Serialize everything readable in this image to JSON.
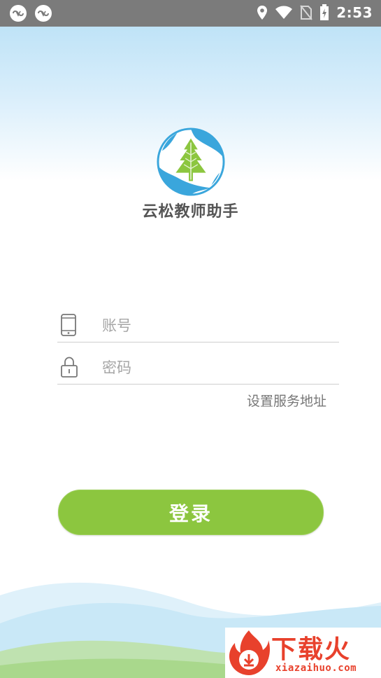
{
  "status_bar": {
    "time": "2:53",
    "icons": [
      "app-notification-icon",
      "app-notification-icon",
      "location-icon",
      "wifi-icon",
      "no-sim-icon",
      "battery-charging-icon"
    ]
  },
  "app": {
    "name": "云松教师助手"
  },
  "login_form": {
    "account_placeholder": "账号",
    "password_placeholder": "密码",
    "server_link": "设置服务地址",
    "login_button": "登录"
  },
  "watermark": {
    "title": "下载火",
    "url": "xiazaihuo.com"
  },
  "colors": {
    "accent": "#8cc63f",
    "status_bar": "#7b7b7b",
    "logo_blue": "#3aa6dc",
    "watermark": "#e8412c"
  }
}
